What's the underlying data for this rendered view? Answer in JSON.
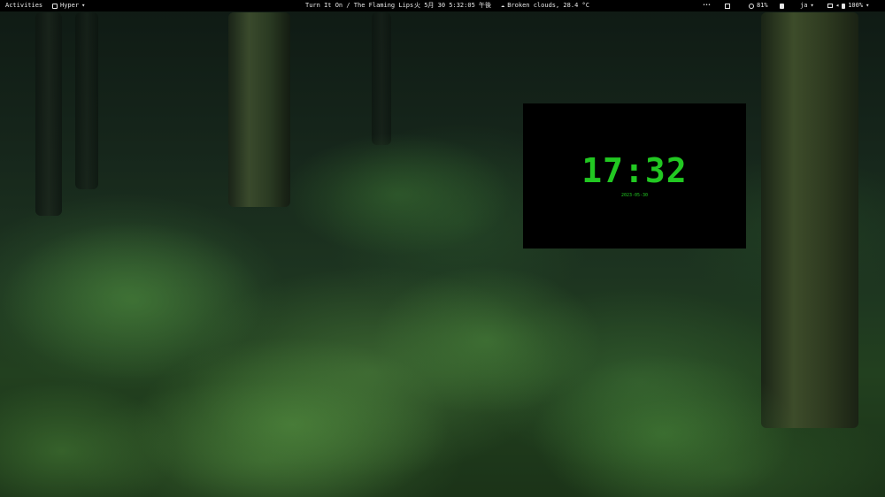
{
  "topbar": {
    "activities": "Activities",
    "app_name": "Hyper",
    "app_dropdown": "▾",
    "media": "Turn It On / The Flaming Lips",
    "datetime": "火 5月 30  5:32:05 午後",
    "weather_icon": "cloud-icon",
    "weather": "Broken clouds, 28.4 °C",
    "overflow": "•••",
    "cpu_icon": "chip-icon",
    "memory_icon": "memory-icon",
    "memory": "81%",
    "clipboard_icon": "clipboard-icon",
    "input_method": "ja",
    "input_dropdown": "▾",
    "network_icon": "network-icon",
    "volume_icon": "speaker-icon",
    "battery_icon": "battery-icon",
    "battery": "100%",
    "system_dropdown": "▾"
  },
  "clock_widget": {
    "time": "17:32",
    "date": "2023-05-30",
    "color": "#22c822"
  },
  "wallpaper": {
    "subject": "forest-fern-wallpaper"
  }
}
